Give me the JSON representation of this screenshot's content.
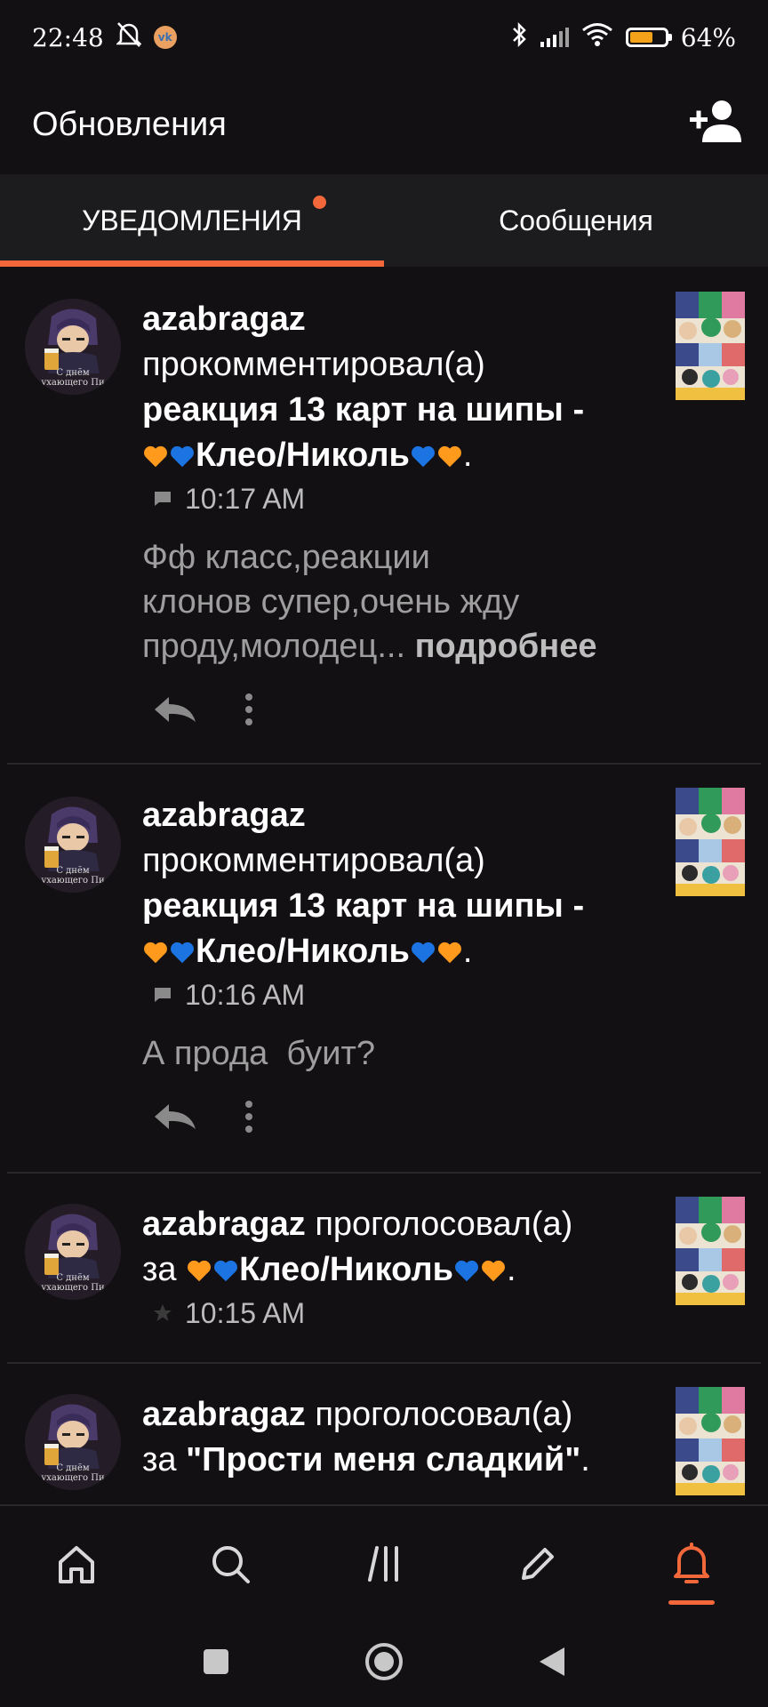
{
  "status_bar": {
    "time": "22:48",
    "battery": "64%",
    "battery_level": 0.64
  },
  "header": {
    "title": "Обновления"
  },
  "tabs": [
    {
      "label": "УВЕДОМЛЕНИЯ",
      "active": true,
      "has_dot": true
    },
    {
      "label": "Сообщения",
      "active": false,
      "has_dot": false
    }
  ],
  "colors": {
    "accent": "#f2683b",
    "background": "#121013",
    "tab_bg": "#1c1b1d",
    "muted_text": "#9e9e9e"
  },
  "avatar_caption": "С днём\nухающего Пи",
  "notifications": [
    {
      "user": "azabragaz",
      "action": "прокомментировал(а)",
      "target_line1": "реакция 13 карт на шипы -",
      "target_line2": "Клео/Николь",
      "time_icon": "comment-icon",
      "time": "10:17 AM",
      "comment_lines": [
        "Фф класс,реакции",
        "клонов супер,очень жду",
        "проду,молодец..."
      ],
      "more_label": "подробнее"
    },
    {
      "user": "azabragaz",
      "action": "прокомментировал(а)",
      "target_line1": "реакция 13 карт на шипы -",
      "target_line2": "Клео/Николь",
      "time_icon": "comment-icon",
      "time": "10:16 AM",
      "comment_lines": [
        "А прода  буит?"
      ]
    },
    {
      "user": "azabragaz",
      "action": "проголосовал(а)",
      "prep": "за",
      "target": "Клео/Николь",
      "time_icon": "star-icon",
      "time": "10:15 AM"
    },
    {
      "user": "azabragaz",
      "action": "проголосовал(а)",
      "prep": "за",
      "target": "\"Прости меня сладкий\""
    }
  ],
  "bottom_nav": [
    {
      "name": "home",
      "icon": "home-icon",
      "active": false
    },
    {
      "name": "search",
      "icon": "search-icon",
      "active": false
    },
    {
      "name": "library",
      "icon": "library-icon",
      "active": false
    },
    {
      "name": "write",
      "icon": "pencil-icon",
      "active": false
    },
    {
      "name": "notifications",
      "icon": "bell-icon",
      "active": true
    }
  ]
}
